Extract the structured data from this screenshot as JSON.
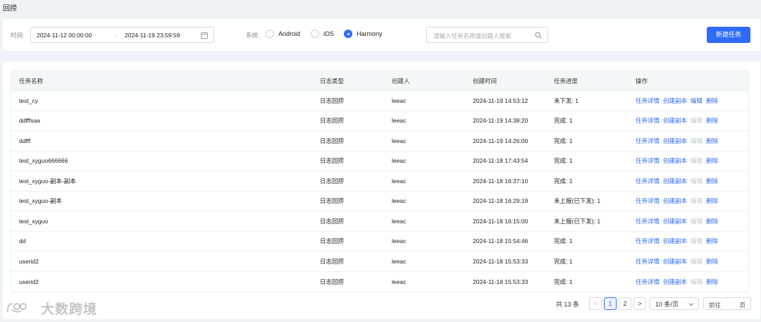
{
  "page": {
    "title": "回捞"
  },
  "filters": {
    "time_label": "时间:",
    "start": "2024-11-12 00:00:00",
    "separator": "-",
    "end": "2024-11-19 23:59:59",
    "system_label": "系统:",
    "systems": [
      {
        "label": "Android",
        "selected": false
      },
      {
        "label": "iOS",
        "selected": false
      },
      {
        "label": "Harmony",
        "selected": true
      }
    ],
    "search_placeholder": "请输入任务名称或创建人搜索",
    "new_task": "新建任务"
  },
  "table": {
    "headers": [
      "任务名称",
      "日志类型",
      "创建人",
      "创建时间",
      "任务进度",
      "操作"
    ],
    "rows": [
      {
        "name": "test_cy",
        "type": "日志回捞",
        "creator": "leeac",
        "time": "2024-11-19 14:53:12",
        "progress": "未下发: 1",
        "edit_enabled": true
      },
      {
        "name": "ddfffsaa",
        "type": "日志回捞",
        "creator": "leeac",
        "time": "2024-11-19 14:38:20",
        "progress": "完成: 1",
        "edit_enabled": false
      },
      {
        "name": "ddfff",
        "type": "日志回捞",
        "creator": "leeac",
        "time": "2024-11-19 14:26:00",
        "progress": "完成: 1",
        "edit_enabled": false
      },
      {
        "name": "test_xyguo666666",
        "type": "日志回捞",
        "creator": "leeac",
        "time": "2024-11-18 17:43:54",
        "progress": "完成: 1",
        "edit_enabled": false
      },
      {
        "name": "test_xyguo-副本-副本",
        "type": "日志回捞",
        "creator": "leeac",
        "time": "2024-11-18 16:37:10",
        "progress": "完成: 1",
        "edit_enabled": false
      },
      {
        "name": "test_xyguo-副本",
        "type": "日志回捞",
        "creator": "leeac",
        "time": "2024-11-18 16:29:19",
        "progress": "未上报(已下发): 1",
        "edit_enabled": false
      },
      {
        "name": "test_xyguo",
        "type": "日志回捞",
        "creator": "leeac",
        "time": "2024-11-18 16:15:00",
        "progress": "未上报(已下发): 1",
        "edit_enabled": false
      },
      {
        "name": "dd",
        "type": "日志回捞",
        "creator": "leeac",
        "time": "2024-11-18 15:54:46",
        "progress": "完成: 1",
        "edit_enabled": false
      },
      {
        "name": "userid2",
        "type": "日志回捞",
        "creator": "leeac",
        "time": "2024-11-18 15:53:33",
        "progress": "完成: 1",
        "edit_enabled": false
      },
      {
        "name": "userid2",
        "type": "日志回捞",
        "creator": "leeac",
        "time": "2024-11-18 15:53:33",
        "progress": "完成: 1",
        "edit_enabled": false
      }
    ],
    "actions": {
      "detail": "任务详情",
      "copy": "创建副本",
      "edit": "编辑",
      "delete": "删除"
    }
  },
  "pagination": {
    "total": "共 13 条",
    "prev": "<",
    "pages": [
      "1",
      "2"
    ],
    "current": "1",
    "next": ">",
    "page_size": "10 条/页",
    "jump_prefix": "前往",
    "jump_suffix": "页"
  },
  "watermark": {
    "text": "大数跨境"
  },
  "colors": {
    "primary": "#2f6bf6",
    "disabled": "#c0c4cc",
    "background": "#f0f2f5"
  }
}
